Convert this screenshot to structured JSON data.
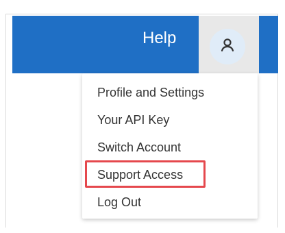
{
  "header": {
    "help_label": "Help",
    "avatar_icon": "user-icon",
    "bar_color": "#1f6fc5"
  },
  "user_menu": {
    "items": [
      {
        "label": "Profile and Settings"
      },
      {
        "label": "Your API Key"
      },
      {
        "label": "Switch Account"
      },
      {
        "label": "Support Access",
        "highlighted": true
      },
      {
        "label": "Log Out"
      }
    ]
  },
  "highlight": {
    "color": "#e5484d"
  }
}
